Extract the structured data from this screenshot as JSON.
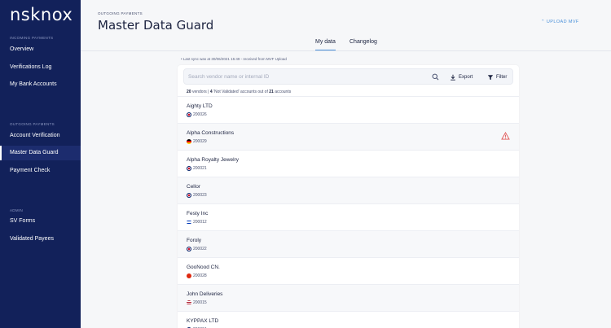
{
  "sidebar": {
    "logo": "nsknox",
    "sections": [
      {
        "label": "INCOMING PAYMENTS",
        "items": [
          {
            "label": "Overview"
          },
          {
            "label": "Verifications Log"
          },
          {
            "label": "My Bank Accounts"
          }
        ]
      },
      {
        "label": "OUTGOING PAYMENTS",
        "items": [
          {
            "label": "Account Verification"
          },
          {
            "label": "Master Data Guard",
            "active": true
          },
          {
            "label": "Payment Check"
          }
        ]
      },
      {
        "label": "ADMIN",
        "items": [
          {
            "label": "SV Forms"
          },
          {
            "label": "Validated Payees"
          }
        ]
      }
    ]
  },
  "header": {
    "breadcrumb": "OUTGOING PAYMENTS",
    "title": "Master Data Guard",
    "upload_label": "⌃ UPLOAD MVF"
  },
  "tabs": [
    {
      "label": "My data",
      "active": true
    },
    {
      "label": "Changelog"
    }
  ],
  "sync_note": "• Last sync was at 30/06/2021 15:49 - received from MVF Upload",
  "toolbar": {
    "search_placeholder": "Search vendor name or internal ID",
    "export_label": "Export",
    "filter_label": "Filter"
  },
  "summary": {
    "vendors": "20",
    "vendors_label": " vendors | ",
    "not_validated": "4",
    "middle_label": " 'Not Validated' accounts out of ",
    "accounts": "21",
    "accounts_label": " accounts"
  },
  "vendors": [
    {
      "name": "Aighty LTD",
      "id": "200026",
      "flag": "uk",
      "warning": false
    },
    {
      "name": "Alpha Constructions",
      "id": "200029",
      "flag": "de",
      "warning": true
    },
    {
      "name": "Alpha Royalty Jewelry",
      "id": "200021",
      "flag": "uk",
      "warning": false
    },
    {
      "name": "Cellor",
      "id": "200023",
      "flag": "uk",
      "warning": false
    },
    {
      "name": "Festy Inc",
      "id": "200012",
      "flag": "il",
      "warning": false
    },
    {
      "name": "Foroly",
      "id": "200022",
      "flag": "uk",
      "warning": false
    },
    {
      "name": "GooNood CN.",
      "id": "200028",
      "flag": "cn",
      "warning": false
    },
    {
      "name": "John Deliveries",
      "id": "200015",
      "flag": "us",
      "warning": false
    },
    {
      "name": "KYPPAX LTD",
      "id": "200024",
      "flag": "uk",
      "warning": false
    }
  ],
  "colors": {
    "sidebar_bg": "#12215a",
    "accent": "#4a90d9",
    "warning": "#e05353"
  }
}
